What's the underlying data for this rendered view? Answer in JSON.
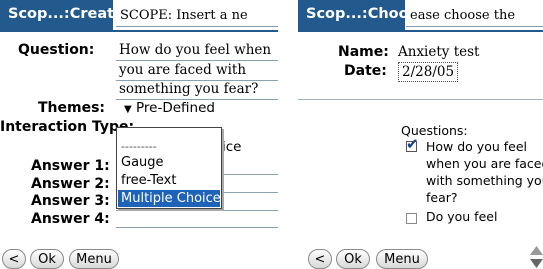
{
  "left": {
    "title": "Scop...:Create n...",
    "title_field": "SCOPE: Insert a ne",
    "question_label": "Question:",
    "question_lines": [
      "How do you feel when",
      "you are faced with",
      "something you fear?"
    ],
    "themes_label": "Themes:",
    "themes_value": "Pre-Defined",
    "interaction_label": "Interaction Type:",
    "interaction_value_partial": "ice",
    "answers": [
      "Answer 1:",
      "Answer 2:",
      "Answer 3:",
      "Answer 4:"
    ],
    "popup": {
      "divider": "---------",
      "options": [
        "Gauge",
        "free-Text",
        "Multiple Choice"
      ],
      "selected": "Multiple Choice"
    },
    "buttons": {
      "back": "<",
      "ok": "Ok",
      "menu": "Menu"
    }
  },
  "right": {
    "title": "Scop...:Choose t...",
    "title_field": "ease choose the",
    "name_label": "Name:",
    "name_value": "Anxiety test",
    "date_label": "Date:",
    "date_value": "2/28/05",
    "questions_heading": "Questions:",
    "q1_lines": [
      "How do you feel",
      "when you are faced",
      "with something you",
      "fear?"
    ],
    "q1_checked": true,
    "q2": "Do you feel",
    "q2_checked": false,
    "buttons": {
      "back": "<",
      "ok": "Ok",
      "menu": "Menu"
    }
  },
  "colors": {
    "title_bar": "#225a8e",
    "selection": "#1f63b8"
  }
}
